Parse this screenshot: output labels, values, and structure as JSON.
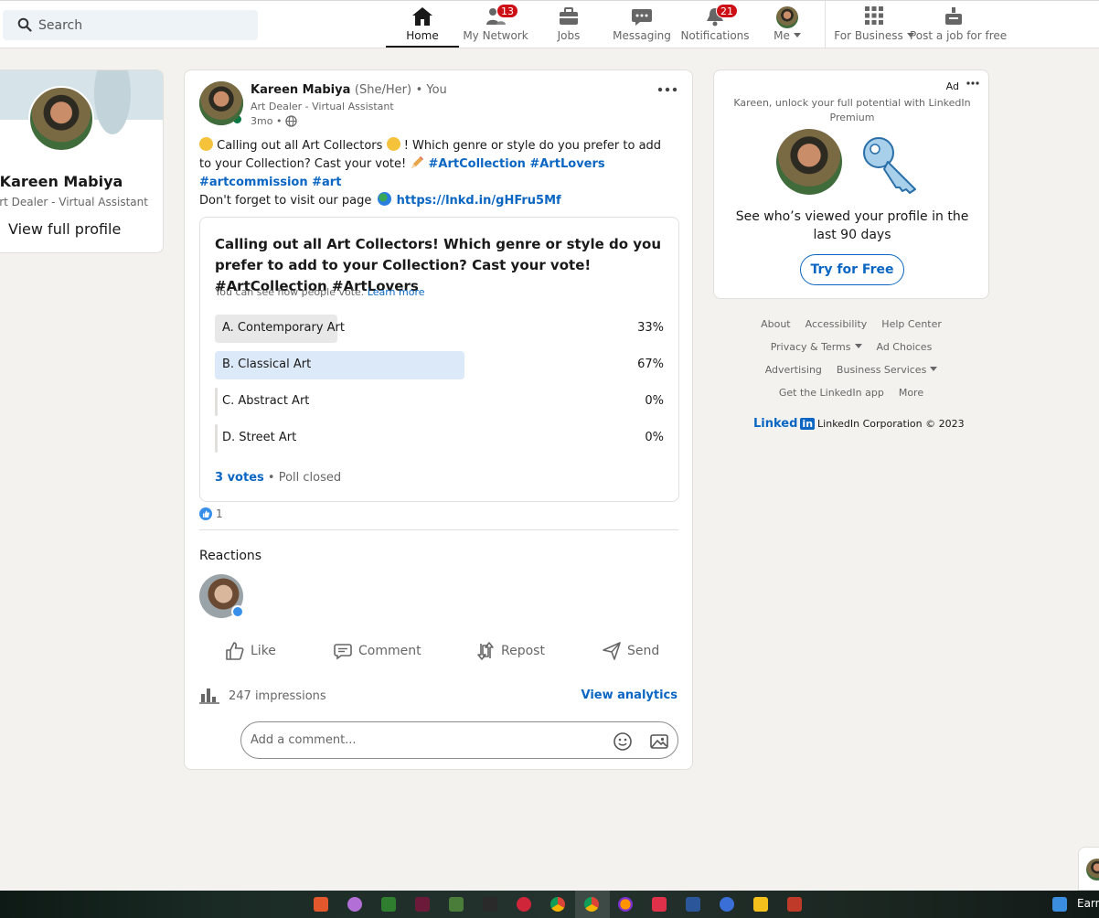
{
  "nav": {
    "search_placeholder": "Search",
    "items": [
      {
        "label": "Home",
        "icon": "home-icon"
      },
      {
        "label": "My Network",
        "icon": "network-icon",
        "badge": "13"
      },
      {
        "label": "Jobs",
        "icon": "briefcase-icon"
      },
      {
        "label": "Messaging",
        "icon": "messaging-icon"
      },
      {
        "label": "Notifications",
        "icon": "bell-icon",
        "badge": "21"
      },
      {
        "label": "Me",
        "icon": "avatar"
      },
      {
        "label": "For Business",
        "icon": "grid-icon"
      },
      {
        "label": "Post a job for free",
        "icon": "job-post-icon"
      }
    ]
  },
  "profile": {
    "name": "Kareen Mabiya",
    "headline": "Art Dealer - Virtual Assistant",
    "view_link": "View full profile"
  },
  "post": {
    "author": "Kareen Mabiya",
    "pronouns": "(She/Her)",
    "relation": "• You",
    "headline": "Art Dealer - Virtual Assistant",
    "time": "3mo •",
    "text_1": " Calling out all Art Collectors ",
    "text_2": " ! Which genre or style do you prefer to add to your Collection? Cast your vote! ",
    "tags": "#ArtCollection #ArtLovers #artcommission #art",
    "text_3": "Don't forget to visit our page ",
    "link": "https://lnkd.in/gHFru5Mf",
    "poll": {
      "question": "Calling out all Art Collectors! Which genre or style do you prefer to add to your Collection? Cast your vote! #ArtCollection #ArtLovers",
      "hint": "You can see how people vote.",
      "hint_link": "Learn more",
      "options": [
        {
          "label": "A. Contemporary Art",
          "percent": "33%",
          "fraction": 0.33
        },
        {
          "label": "B. Classical Art",
          "percent": "67%",
          "fraction": 0.67,
          "selected": true
        },
        {
          "label": "C. Abstract Art",
          "percent": "0%",
          "fraction": 0
        },
        {
          "label": "D. Street Art",
          "percent": "0%",
          "fraction": 0
        }
      ],
      "votes": "3 votes",
      "status": "• Poll closed"
    },
    "reaction_count": "1",
    "reactions_title": "Reactions",
    "actions": {
      "like": "Like",
      "comment": "Comment",
      "repost": "Repost",
      "send": "Send"
    },
    "impressions": "247 impressions",
    "analytics": "View analytics",
    "comment_placeholder": "Add a comment..."
  },
  "ad": {
    "label": "Ad",
    "message": "Kareen, unlock your full potential with LinkedIn Premium",
    "see": "See who’s viewed your profile in the last 90 days",
    "cta": "Try for Free"
  },
  "footer": {
    "row1": [
      "About",
      "Accessibility",
      "Help Center"
    ],
    "row2": [
      "Privacy & Terms",
      "Ad Choices"
    ],
    "row3": [
      "Advertising",
      "Business Services"
    ],
    "row4": [
      "Get the LinkedIn app",
      "More"
    ],
    "brand_linked": "Linked",
    "brand_in": "in",
    "copyright": "LinkedIn Corporation © 2023"
  },
  "taskbar": {
    "tail_text": "Earr"
  },
  "colors": {
    "brand": "#0a66c2",
    "badge": "#cc1016",
    "online": "#057642",
    "selected_option": "#dce9f8"
  }
}
